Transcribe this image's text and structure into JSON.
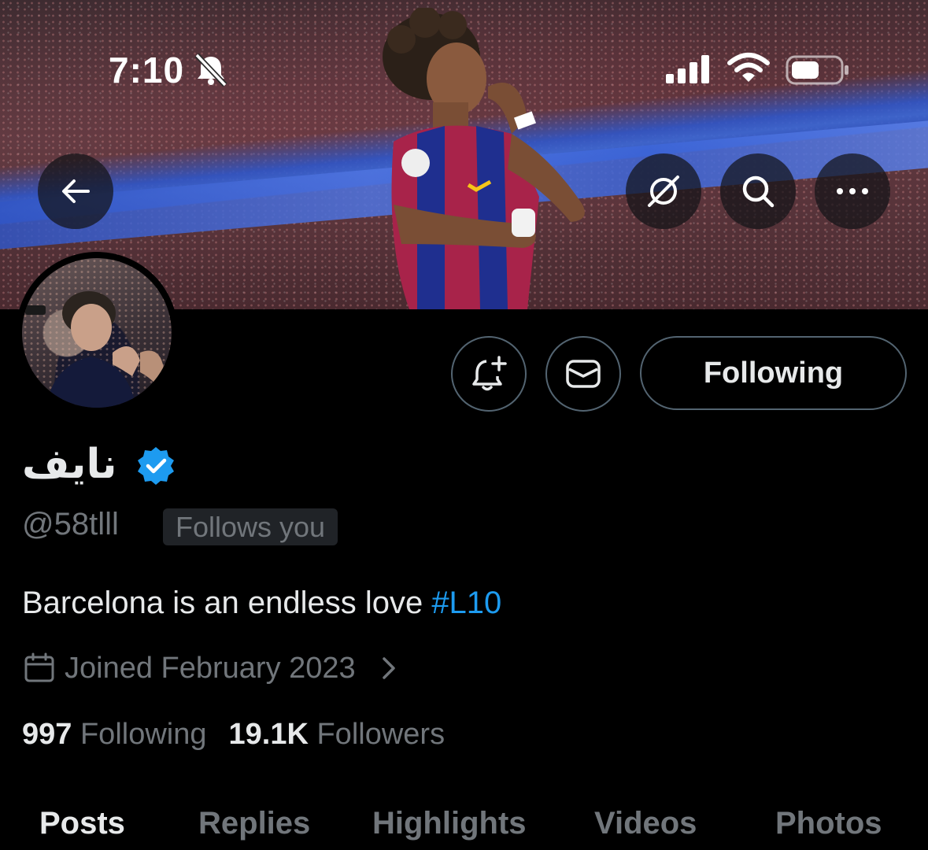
{
  "status_bar": {
    "time": "7:10",
    "icons": [
      "bell-slash-icon",
      "cellular-signal-icon",
      "wifi-icon",
      "battery-icon"
    ]
  },
  "header": {
    "buttons": [
      "back-arrow-icon",
      "grok-icon",
      "search-icon",
      "more-icon"
    ]
  },
  "actions": {
    "notify_icon": "bell-plus-icon",
    "message_icon": "envelope-icon",
    "following_label": "Following"
  },
  "profile": {
    "display_name": "نايف",
    "verified": true,
    "handle": "@58tlll",
    "follows_badge": "Follows you",
    "bio_text": "Barcelona is an endless love ",
    "bio_hashtag": "#L10",
    "joined": "Joined February 2023",
    "following_count": "997",
    "following_label": "Following",
    "followers_count": "19.1K",
    "followers_label": "Followers"
  },
  "tabs": [
    "Posts",
    "Replies",
    "Highlights",
    "Videos",
    "Photos"
  ],
  "colors": {
    "accent": "#1d9bf0",
    "secondary_text": "#71767b",
    "border": "#536471",
    "background": "#000000"
  }
}
